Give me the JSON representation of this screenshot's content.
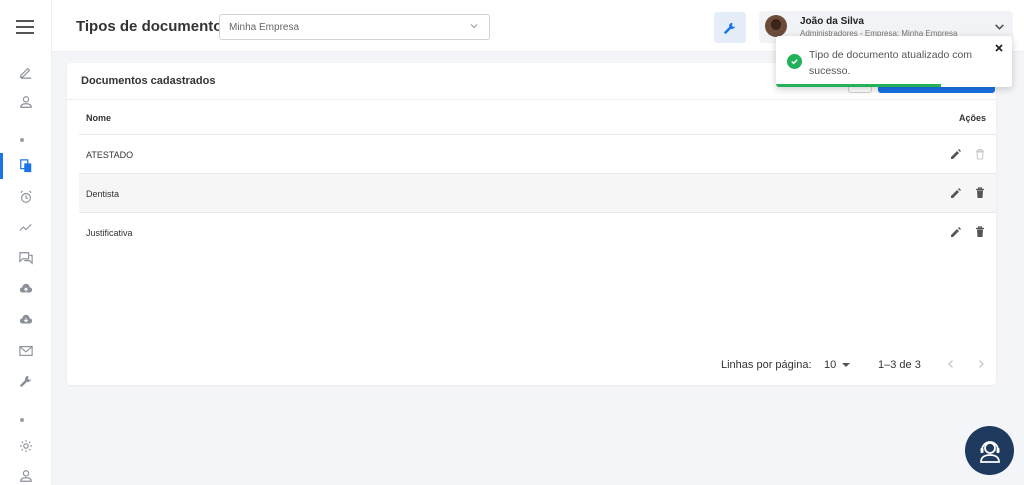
{
  "header": {
    "title": "Tipos de documentos",
    "company_select": {
      "value": "Minha Empresa"
    },
    "user": {
      "name": "João da Silva",
      "role": "Administradores - Empresa: Minha Empresa"
    }
  },
  "sidebar": {
    "items": [
      {
        "icon": "pencil-icon"
      },
      {
        "icon": "user-icon"
      },
      {
        "icon": "documents-icon",
        "active": true
      },
      {
        "icon": "alarm-clock-icon"
      },
      {
        "icon": "chart-line-icon"
      },
      {
        "icon": "chat-icon"
      },
      {
        "icon": "cloud-upload-icon"
      },
      {
        "icon": "cloud-download-icon"
      },
      {
        "icon": "mail-icon"
      },
      {
        "icon": "wrench-icon"
      },
      {
        "icon": "gear-icon"
      },
      {
        "icon": "user-icon"
      }
    ]
  },
  "card": {
    "title": "Documentos cadastrados",
    "table": {
      "columns": [
        "Nome",
        "Ações"
      ],
      "rows": [
        {
          "name": "ATESTADO",
          "delete_disabled": true
        },
        {
          "name": "Dentista",
          "delete_disabled": false
        },
        {
          "name": "Justificativa",
          "delete_disabled": false
        }
      ]
    },
    "pagination": {
      "rows_per_page_label": "Linhas por página:",
      "rows_per_page": "10",
      "range": "1–3 de 3"
    }
  },
  "toast": {
    "message": "Tipo de documento atualizado com sucesso.",
    "progress": 0.7,
    "color": "#22b058"
  },
  "colors": {
    "accent": "#1a73e8",
    "success": "#22b058",
    "fab": "#1e3a5f"
  }
}
